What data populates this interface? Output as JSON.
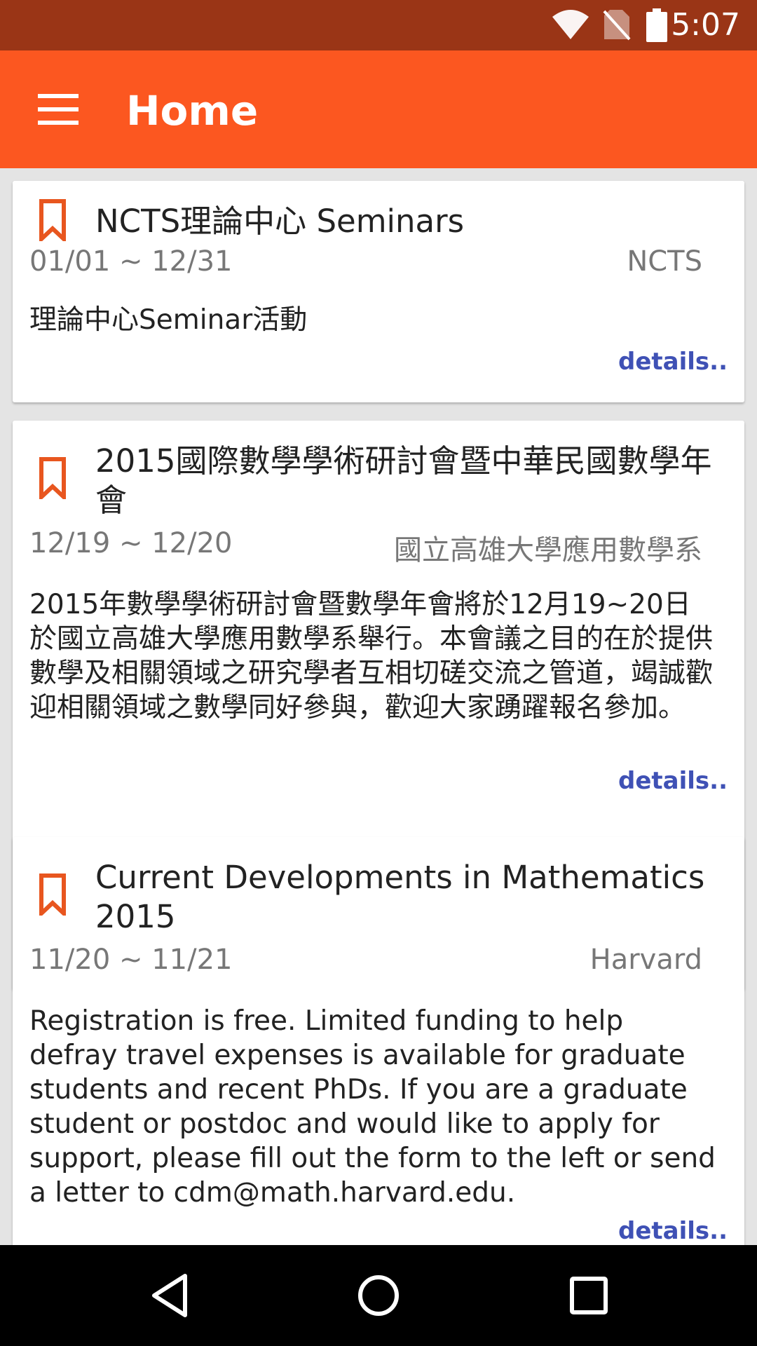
{
  "status_bar": {
    "time": "5:07",
    "icons": [
      "wifi-icon",
      "no-sim-icon",
      "battery-icon"
    ],
    "color": "#9a3516"
  },
  "app_bar": {
    "title": "Home",
    "menu_icon": "hamburger-menu-icon",
    "color": "#fc5720"
  },
  "events": [
    {
      "title": "NCTS理論中心 Seminars",
      "date": "01/01 ~ 12/31",
      "organizer": "NCTS",
      "description": "理論中心Seminar活動",
      "details_label": "details.."
    },
    {
      "title": "2015國際數學學術研討會暨中華民國數學年會",
      "date": "12/19 ~ 12/20",
      "organizer": "國立高雄大學應用數學系",
      "description": "2015年數學學術研討會暨數學年會將於12月19~20日於國立高雄大學應用數學系舉行。本會議之目的在於提供數學及相關領域之研究學者互相切磋交流之管道，竭誠歡迎相關領域之數學同好參與，歡迎大家踴躍報名參加。",
      "details_label": "details.."
    },
    {
      "title": "Current Developments in Mathematics 2015",
      "date": "11/20 ~ 11/21",
      "organizer": "Harvard",
      "description": "Registration is free. Limited funding to help defray travel expenses is available for graduate students and recent PhDs. If you are a graduate student or postdoc and would like to apply for support, please fill out the form to the left or send a letter to cdm@math.harvard.edu.",
      "details_label": "details.."
    }
  ],
  "colors": {
    "bookmark": "#e8561f",
    "details_link": "#3f51b5"
  },
  "nav_bar": {
    "buttons": [
      "back-icon",
      "home-icon",
      "recents-icon"
    ]
  }
}
